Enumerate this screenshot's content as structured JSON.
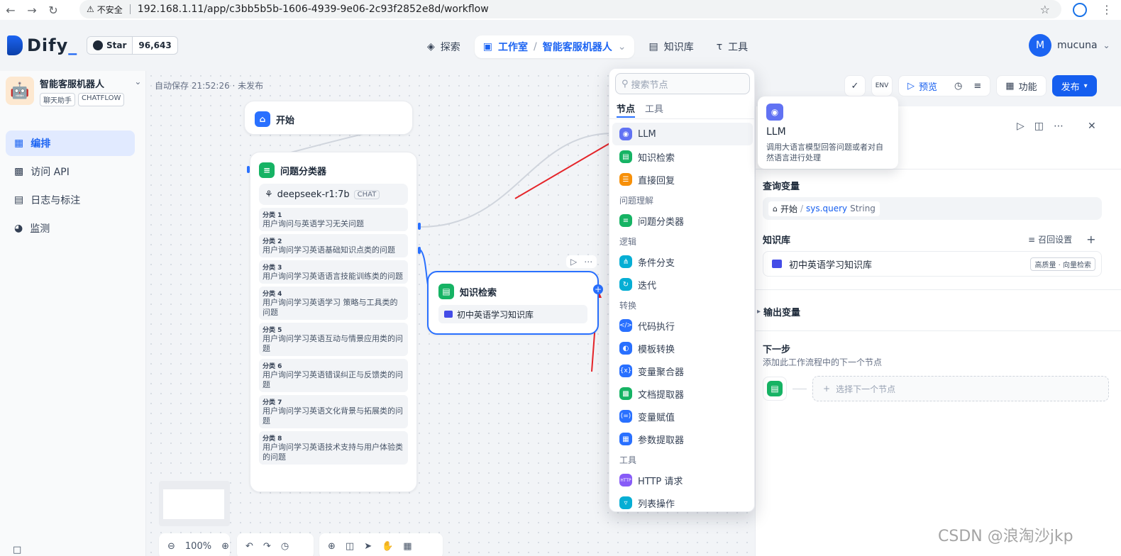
{
  "browser": {
    "insecure_label": "不安全",
    "url": "192.168.1.11/app/c3bb5b5b-1606-4939-9e06-2c93f2852e8d/workflow"
  },
  "header": {
    "logo_text": "Dify",
    "github_star_label": "Star",
    "github_star_count": "96,643",
    "nav": {
      "explore": "探索",
      "studio": "工作室",
      "app_name": "智能客服机器人",
      "knowledge": "知识库",
      "tools": "工具"
    },
    "user": {
      "initial": "M",
      "name": "mucuna"
    }
  },
  "sidebar": {
    "app_name": "智能客服机器人",
    "tag_mode": "聊天助手",
    "tag_type": "CHATFLOW",
    "items": [
      {
        "label": "编排",
        "icon": "layout-icon",
        "active": true
      },
      {
        "label": "访问 API",
        "icon": "terminal-icon",
        "active": false
      },
      {
        "label": "日志与标注",
        "icon": "log-icon",
        "active": false
      },
      {
        "label": "监测",
        "icon": "monitor-icon",
        "active": false
      }
    ]
  },
  "canvas": {
    "autosave": "自动保存 21:52:26 · 未发布",
    "start_node": {
      "title": "开始"
    },
    "classifier_node": {
      "title": "问题分类器",
      "model": "deepseek-r1:7b",
      "model_tag": "CHAT",
      "classes": [
        {
          "name": "分类 1",
          "text": "用户询问与英语学习无关问题"
        },
        {
          "name": "分类 2",
          "text": "用户询问学习英语基础知识点类的问题"
        },
        {
          "name": "分类 3",
          "text": "用户询问学习英语语言技能训练类的问题"
        },
        {
          "name": "分类 4",
          "text": "用户询问学习英语学习 策略与工具类的问题"
        },
        {
          "name": "分类 5",
          "text": "用户询问学习英语互动与情景应用类的问题"
        },
        {
          "name": "分类 6",
          "text": "用户询问学习英语错误纠正与反馈类的问题"
        },
        {
          "name": "分类 7",
          "text": "用户询问学习英语文化背景与拓展类的问题"
        },
        {
          "name": "分类 8",
          "text": "用户询问学习英语技术支持与用户体验类的问题"
        }
      ]
    },
    "knowledge_node": {
      "title": "知识检索",
      "kb_name": "初中英语学习知识库"
    },
    "zoom": "100%"
  },
  "picker": {
    "search_placeholder": "搜索节点",
    "tabs": [
      "节点",
      "工具"
    ],
    "groups": [
      {
        "label": "",
        "items": [
          {
            "label": "LLM",
            "icon": "llm-icon",
            "color": "#6172f3"
          },
          {
            "label": "知识检索",
            "icon": "book-icon",
            "color": "#16b364"
          },
          {
            "label": "直接回复",
            "icon": "reply-icon",
            "color": "#f79009"
          }
        ]
      },
      {
        "label": "问题理解",
        "items": [
          {
            "label": "问题分类器",
            "icon": "classifier-icon",
            "color": "#16b364"
          }
        ]
      },
      {
        "label": "逻辑",
        "items": [
          {
            "label": "条件分支",
            "icon": "branch-icon",
            "color": "#06aed4"
          },
          {
            "label": "迭代",
            "icon": "loop-icon",
            "color": "#06aed4"
          }
        ]
      },
      {
        "label": "转换",
        "items": [
          {
            "label": "代码执行",
            "icon": "code-icon",
            "color": "#2970ff"
          },
          {
            "label": "模板转换",
            "icon": "template-icon",
            "color": "#2970ff"
          },
          {
            "label": "变量聚合器",
            "icon": "aggregator-icon",
            "color": "#2970ff"
          },
          {
            "label": "文档提取器",
            "icon": "doc-extract-icon",
            "color": "#16b364"
          },
          {
            "label": "变量赋值",
            "icon": "assign-icon",
            "color": "#2970ff"
          },
          {
            "label": "参数提取器",
            "icon": "param-icon",
            "color": "#2970ff"
          }
        ]
      },
      {
        "label": "工具",
        "items": [
          {
            "label": "HTTP 请求",
            "icon": "http-icon",
            "color": "#875bf7"
          },
          {
            "label": "列表操作",
            "icon": "filter-icon",
            "color": "#06aed4"
          }
        ]
      }
    ]
  },
  "tooltip": {
    "title": "LLM",
    "description": "调用大语言模型回答问题或者对自然语言进行处理"
  },
  "actions": {
    "preview": "预览",
    "features": "功能",
    "publish": "发布"
  },
  "panel": {
    "query_label": "查询变量",
    "query_source": "开始",
    "query_var": "sys.query",
    "query_type": "String",
    "kb_label": "知识库",
    "recall_settings": "召回设置",
    "kb_name": "初中英语学习知识库",
    "kb_badge": "高质量 · 向量检索",
    "output_label": "输出变量",
    "next_label": "下一步",
    "next_desc": "添加此工作流程中的下一个节点",
    "next_placeholder": "选择下一个节点"
  },
  "watermark": "CSDN @浪淘沙jkp"
}
